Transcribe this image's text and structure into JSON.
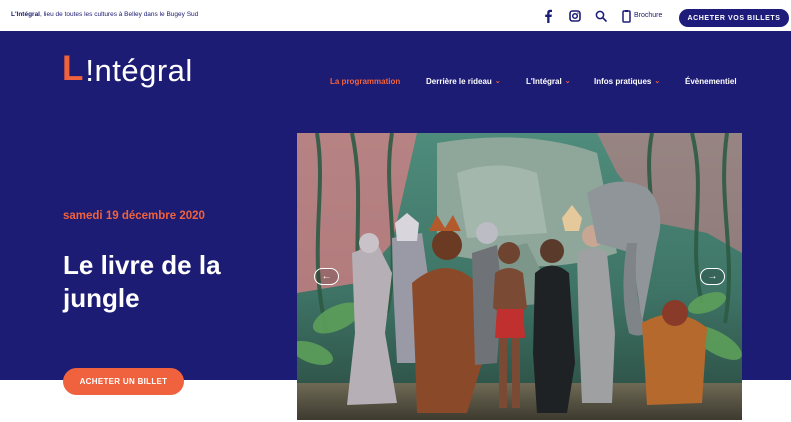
{
  "topbar": {
    "tagline_brand": "L'Intégral",
    "tagline_rest": ", lieu de toutes les cultures à Belley dans le Bugey Sud",
    "brochure_label": "Brochure",
    "tickets_label": "ACHETER VOS BILLETS",
    "icons": [
      "facebook-icon",
      "instagram-icon",
      "search-icon",
      "brochure-icon"
    ]
  },
  "logo": {
    "l": "L",
    "rest": "!ntégral"
  },
  "nav": {
    "items": [
      {
        "label": "La programmation",
        "active": true
      },
      {
        "label": "Derrière le rideau",
        "dropdown": true
      },
      {
        "label": "L'Intégral",
        "dropdown": true
      },
      {
        "label": "Infos pratiques",
        "dropdown": true
      },
      {
        "label": "Évènementiel"
      }
    ],
    "chevron": "⌄"
  },
  "hero": {
    "date": "samedi 19 décembre 2020",
    "title": "Le livre de la jungle",
    "buy_label": "ACHETER UN BILLET",
    "prev_arrow": "←",
    "next_arrow": "→"
  },
  "colors": {
    "navy": "#1d1c74",
    "accent": "#f0623d",
    "white": "#ffffff"
  }
}
